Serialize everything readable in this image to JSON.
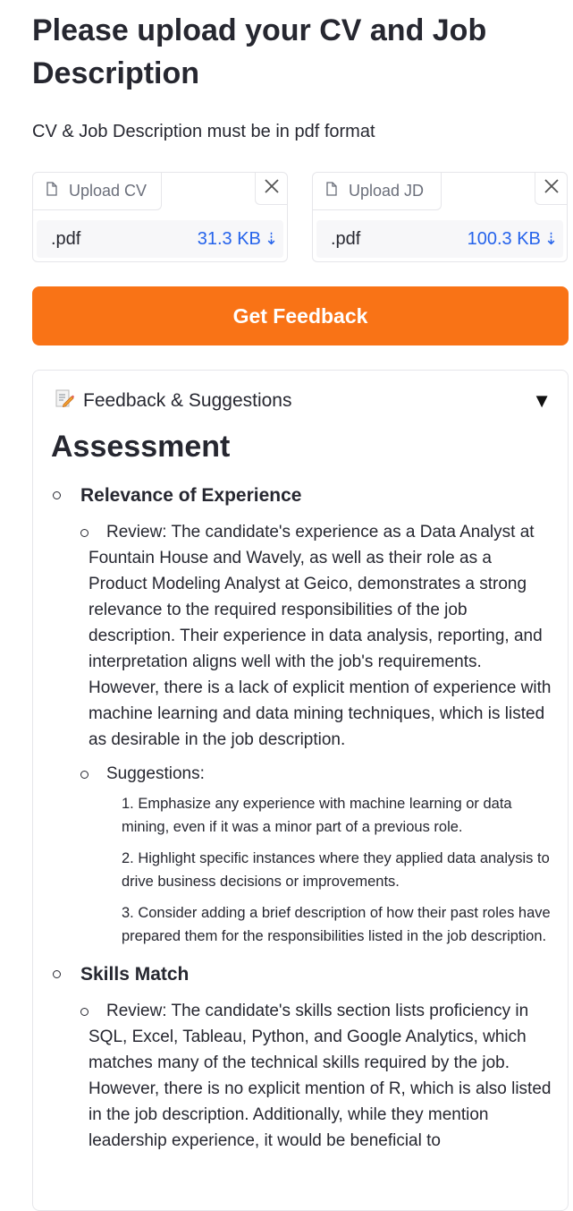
{
  "header": {
    "title": "Please upload your CV and Job Description",
    "subtitle": "CV & Job Description must be in pdf format"
  },
  "uploads": [
    {
      "tab_label": "Upload CV",
      "file_name": ".pdf",
      "file_size": "31.3 KB",
      "icon": "file-icon"
    },
    {
      "tab_label": "Upload JD",
      "file_name": ".pdf",
      "file_size": "100.3 KB",
      "icon": "file-icon"
    }
  ],
  "action": {
    "label": "Get Feedback",
    "color": "#f97316"
  },
  "panel": {
    "title": "Feedback & Suggestions",
    "heading": "Assessment",
    "sections": [
      {
        "title": "Relevance of Experience",
        "review": "Review: The candidate's experience as a Data Analyst at Fountain House and Wavely, as well as their role as a Product Modeling Analyst at Geico, demonstrates a strong relevance to the required responsibilities of the job description. Their experience in data analysis, reporting, and interpretation aligns well with the job's requirements. However, there is a lack of explicit mention of experience with machine learning and data mining techniques, which is listed as desirable in the job description.",
        "suggestions_label": "Suggestions:",
        "suggestions": [
          "1. Emphasize any experience with machine learning or data mining, even if it was a minor part of a previous role.",
          "2. Highlight specific instances where they applied data analysis to drive business decisions or improvements.",
          "3. Consider adding a brief description of how their past roles have prepared them for the responsibilities listed in the job description."
        ]
      },
      {
        "title": "Skills Match",
        "review": "Review: The candidate's skills section lists proficiency in SQL, Excel, Tableau, Python, and Google Analytics, which matches many of the technical skills required by the job. However, there is no explicit mention of R, which is also listed in the job description. Additionally, while they mention leadership experience, it would be beneficial to"
      }
    ]
  }
}
